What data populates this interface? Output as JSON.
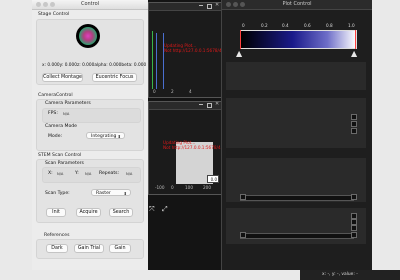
{
  "control": {
    "title": "Control",
    "stage_control": {
      "title": "Stage Control",
      "coords": "x: 0.000y: 0.000z: 0.000alpha: 0.000beta: 0.000",
      "collect_montage": "Collect Montage",
      "eucentric_focus": "Eucentric Focus"
    },
    "camera_control": {
      "title": "CameraControl",
      "params_title": "Camera Parameters",
      "fps_label": "FPS:",
      "fps_value": "N/A",
      "mode_title": "Camera Mode",
      "mode_label": "Mode:",
      "mode_value": "Integrating"
    },
    "stem_scan": {
      "title": "STEM Scan Control",
      "params_title": "Scan Parameters",
      "x_label": "X:",
      "x_value": "N/A",
      "y_label": "Y:",
      "y_value": "N/A",
      "repeats_label": "Repeats:",
      "repeats_value": "N/A",
      "scan_type_label": "Scan Type:",
      "scan_type_value": "Raster",
      "init": "Init",
      "acquire": "Acquire",
      "search": "Search"
    },
    "references": {
      "title": "References",
      "dark": "Dark",
      "gain_trial": "Gain Trial",
      "gain": "Gain"
    }
  },
  "plot_top": {
    "msg_line1": "Updating Plot...",
    "msg_line2": "Not http://127.0.0.1:5678/4",
    "ticks": [
      "0",
      "2",
      "4"
    ]
  },
  "plot_bottom": {
    "msg_line1": "Updating Plot...",
    "msg_line2": "Not http://127.0.0.1:5678/4",
    "ticks": [
      "-100",
      "0",
      "100",
      "200"
    ],
    "value_box": "0.0"
  },
  "plot_control": {
    "title": "Plot Control",
    "scale_ticks": [
      "0",
      "0.2",
      "0.4",
      "0.6",
      "0.8",
      "1.0"
    ]
  },
  "status_bar": {
    "text": "x: -, y: -, value: -"
  }
}
